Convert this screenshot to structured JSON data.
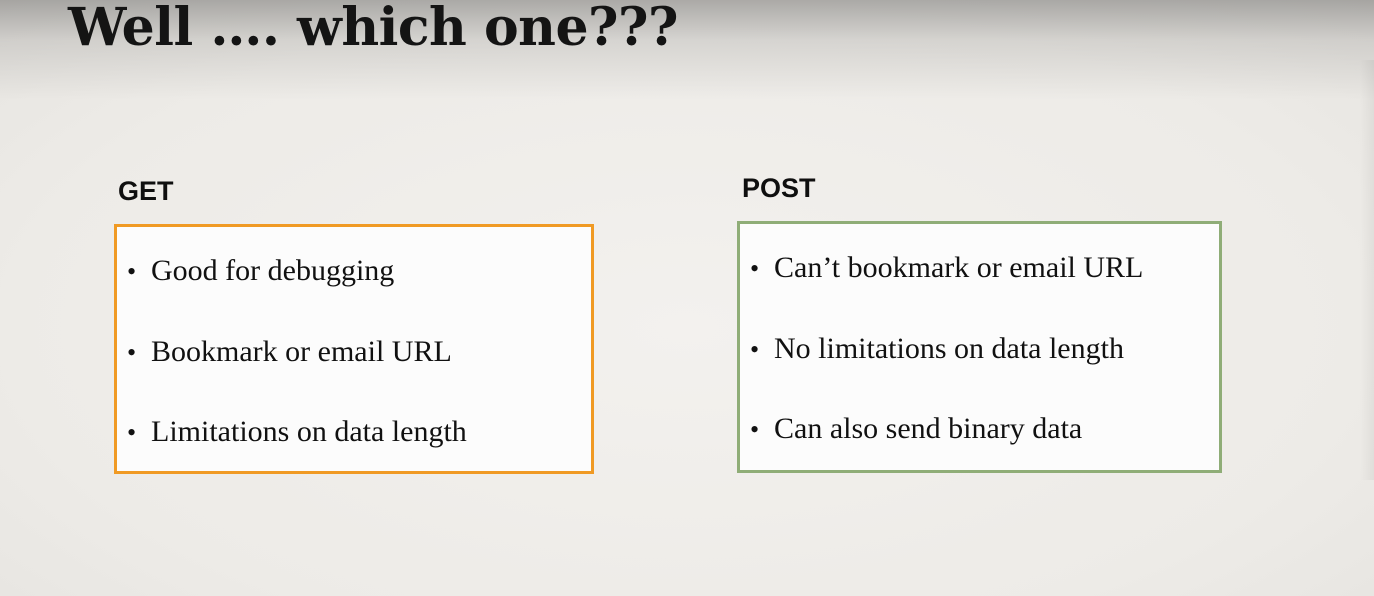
{
  "slide": {
    "title": "Well …. which one???",
    "columns": [
      {
        "label": "GET",
        "border_color": "#f09a24",
        "items": [
          "Good for debugging",
          "Bookmark or email URL",
          "Limitations on data length"
        ]
      },
      {
        "label": "POST",
        "border_color": "#8fad77",
        "items": [
          "Can’t bookmark or email URL",
          "No limitations on data length",
          "Can also send binary data"
        ]
      }
    ]
  }
}
